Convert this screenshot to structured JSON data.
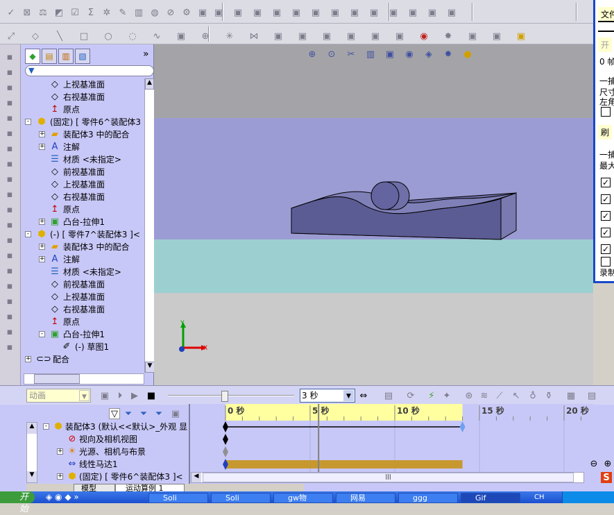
{
  "toolbar_row1": [
    "spell-check-icon",
    "measure-icon",
    "mass-properties-icon",
    "section-icon",
    "check-icon",
    "sum-icon",
    "sensor-icon",
    "edit-icon",
    "zebra-icon",
    "hide-icon",
    "rebuild-icon",
    "options-icon",
    "new-part-icon",
    "insert-component-icon",
    "mate-icon",
    "move-component-icon",
    "smart-fastener-icon",
    "explode-icon",
    "interference-icon",
    "pattern-icon",
    "spring-icon",
    "sketch-icon",
    "exit-icon",
    "rotate-icon",
    "section-view-icon",
    "view-icon"
  ],
  "toolbar_row2": [
    "smart-dimension-icon",
    "eraser-icon",
    "line-icon",
    "rectangle-icon",
    "circle-icon",
    "arc-icon",
    "spline-icon",
    "fillet-icon",
    "point-icon",
    "centerline-icon",
    "mirror-icon",
    "offset-icon",
    "trim-icon",
    "convert-icon",
    "plane-icon",
    "grid-icon",
    "snap-icon",
    "color-icon",
    "appearance-icon",
    "relation-icon",
    "display-icon",
    "grid2-icon"
  ],
  "view_toolbar": [
    "zoom-fit-icon",
    "zoom-area-icon",
    "previous-view-icon",
    "section-view-icon",
    "view-orientation-icon",
    "display-style-icon",
    "hide-show-icon",
    "appearance-icon",
    "scene-icon"
  ],
  "tree": {
    "tabs": [
      "feature-manager-tab",
      "property-manager-tab",
      "configuration-manager-tab",
      "display-manager-tab"
    ],
    "more": "»",
    "items": [
      {
        "label": "上视基准面",
        "level": 1,
        "icon": "plane",
        "exp": ""
      },
      {
        "label": "右视基准面",
        "level": 1,
        "icon": "plane",
        "exp": ""
      },
      {
        "label": "原点",
        "level": 1,
        "icon": "origin",
        "exp": ""
      },
      {
        "label": "(固定) [ 零件6^装配体3",
        "level": 0,
        "icon": "part",
        "exp": "-"
      },
      {
        "label": "装配体3 中的配合",
        "level": 1,
        "icon": "mates-folder",
        "exp": "+"
      },
      {
        "label": "注解",
        "level": 1,
        "icon": "annotation",
        "exp": "+"
      },
      {
        "label": "材质 <未指定>",
        "level": 1,
        "icon": "material",
        "exp": ""
      },
      {
        "label": "前视基准面",
        "level": 1,
        "icon": "plane",
        "exp": ""
      },
      {
        "label": "上视基准面",
        "level": 1,
        "icon": "plane",
        "exp": ""
      },
      {
        "label": "右视基准面",
        "level": 1,
        "icon": "plane",
        "exp": ""
      },
      {
        "label": "原点",
        "level": 1,
        "icon": "origin",
        "exp": ""
      },
      {
        "label": "凸台-拉伸1",
        "level": 1,
        "icon": "extrude",
        "exp": "+"
      },
      {
        "label": "(-) [ 零件7^装配体3 ]<",
        "level": 0,
        "icon": "part",
        "exp": "-"
      },
      {
        "label": "装配体3 中的配合",
        "level": 1,
        "icon": "mates-folder",
        "exp": "+"
      },
      {
        "label": "注解",
        "level": 1,
        "icon": "annotation",
        "exp": "+"
      },
      {
        "label": "材质 <未指定>",
        "level": 1,
        "icon": "material",
        "exp": ""
      },
      {
        "label": "前视基准面",
        "level": 1,
        "icon": "plane",
        "exp": ""
      },
      {
        "label": "上视基准面",
        "level": 1,
        "icon": "plane",
        "exp": ""
      },
      {
        "label": "右视基准面",
        "level": 1,
        "icon": "plane",
        "exp": ""
      },
      {
        "label": "原点",
        "level": 1,
        "icon": "origin",
        "exp": ""
      },
      {
        "label": "凸台-拉伸1",
        "level": 1,
        "icon": "extrude",
        "exp": "-"
      },
      {
        "label": "(-) 草图1",
        "level": 2,
        "icon": "sketch",
        "exp": ""
      },
      {
        "label": "配合",
        "level": -1,
        "icon": "mates",
        "exp": "+"
      }
    ]
  },
  "right_panel": {
    "texts": [
      "文件",
      "开",
      "0 帧",
      "一捕",
      "尺寸",
      "左角",
      "刷",
      "一捕",
      "最大",
      "录制"
    ],
    "checkboxes": [
      false,
      true,
      true,
      true,
      true,
      true,
      false
    ]
  },
  "viewport": {
    "colors": {
      "top": "#a4a4a8",
      "band1": "#9c9cd4",
      "band2": "#9cd0d0",
      "floor": "#cacaca",
      "part": "#6a6aa0"
    },
    "triad": {
      "x": "X",
      "y": "Y"
    }
  },
  "motion": {
    "study_type": "动画",
    "playback_speed": "3 秒",
    "slider_fraction": 0.45,
    "time_ticks": [
      "0 秒",
      "5 秒",
      "10 秒",
      "15 秒",
      "20 秒"
    ],
    "tick_values": [
      0,
      5,
      10,
      15,
      20
    ],
    "duration": 14,
    "current_time": 5.5,
    "rows": [
      {
        "label": "装配体3  (默认<<默认>_外观 显",
        "exp": "-",
        "icon": "assembly",
        "keys": [
          0,
          14
        ],
        "line": true
      },
      {
        "label": "视向及相机视图",
        "exp": "",
        "icon": "camera-view",
        "keys": [
          0
        ]
      },
      {
        "label": "光源、相机与布景",
        "exp": "+",
        "icon": "lights",
        "keys": [
          0
        ],
        "gray": true
      },
      {
        "label": "线性马达1",
        "exp": "",
        "icon": "linear-motor",
        "keys": [
          0
        ],
        "bar": [
          0,
          14
        ]
      },
      {
        "label": "(固定) [ 零件6^装配体3 ]<",
        "exp": "+",
        "icon": "part",
        "keys": []
      }
    ],
    "tabs": [
      "模型",
      "运动算例 1"
    ],
    "bar_color": "#c89830"
  },
  "taskbar": {
    "start": "开始",
    "tasks": [
      "Soli",
      "Soli",
      "gw物",
      "网易",
      "ggg",
      "Gif"
    ],
    "tray": "CH"
  }
}
